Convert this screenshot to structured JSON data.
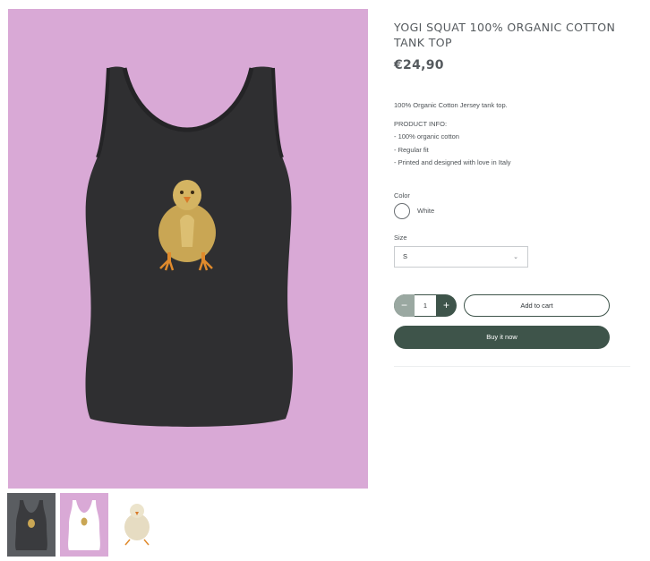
{
  "product": {
    "title": "YOGI SQUAT 100% ORGANIC COTTON TANK TOP",
    "price": "€24,90",
    "description": {
      "intro": "100% Organic Cotton Jersey tank top.",
      "info_heading": "PRODUCT INFO:",
      "info_items": [
        "- 100% organic cotton",
        "- Regular fit",
        "- Printed and designed with love in Italy"
      ]
    }
  },
  "options": {
    "color_label": "Color",
    "color_value": "White",
    "size_label": "Size",
    "size_value": "S",
    "size_chevron_icon": "chevron-down-icon"
  },
  "cart": {
    "quantity": "1",
    "minus_symbol": "−",
    "plus_symbol": "+",
    "add_label": "Add to cart",
    "buy_label": "Buy it now"
  },
  "colors": {
    "accent": "#3e544a",
    "image_background": "#d9a9d6",
    "shirt": "#2f2f31"
  }
}
